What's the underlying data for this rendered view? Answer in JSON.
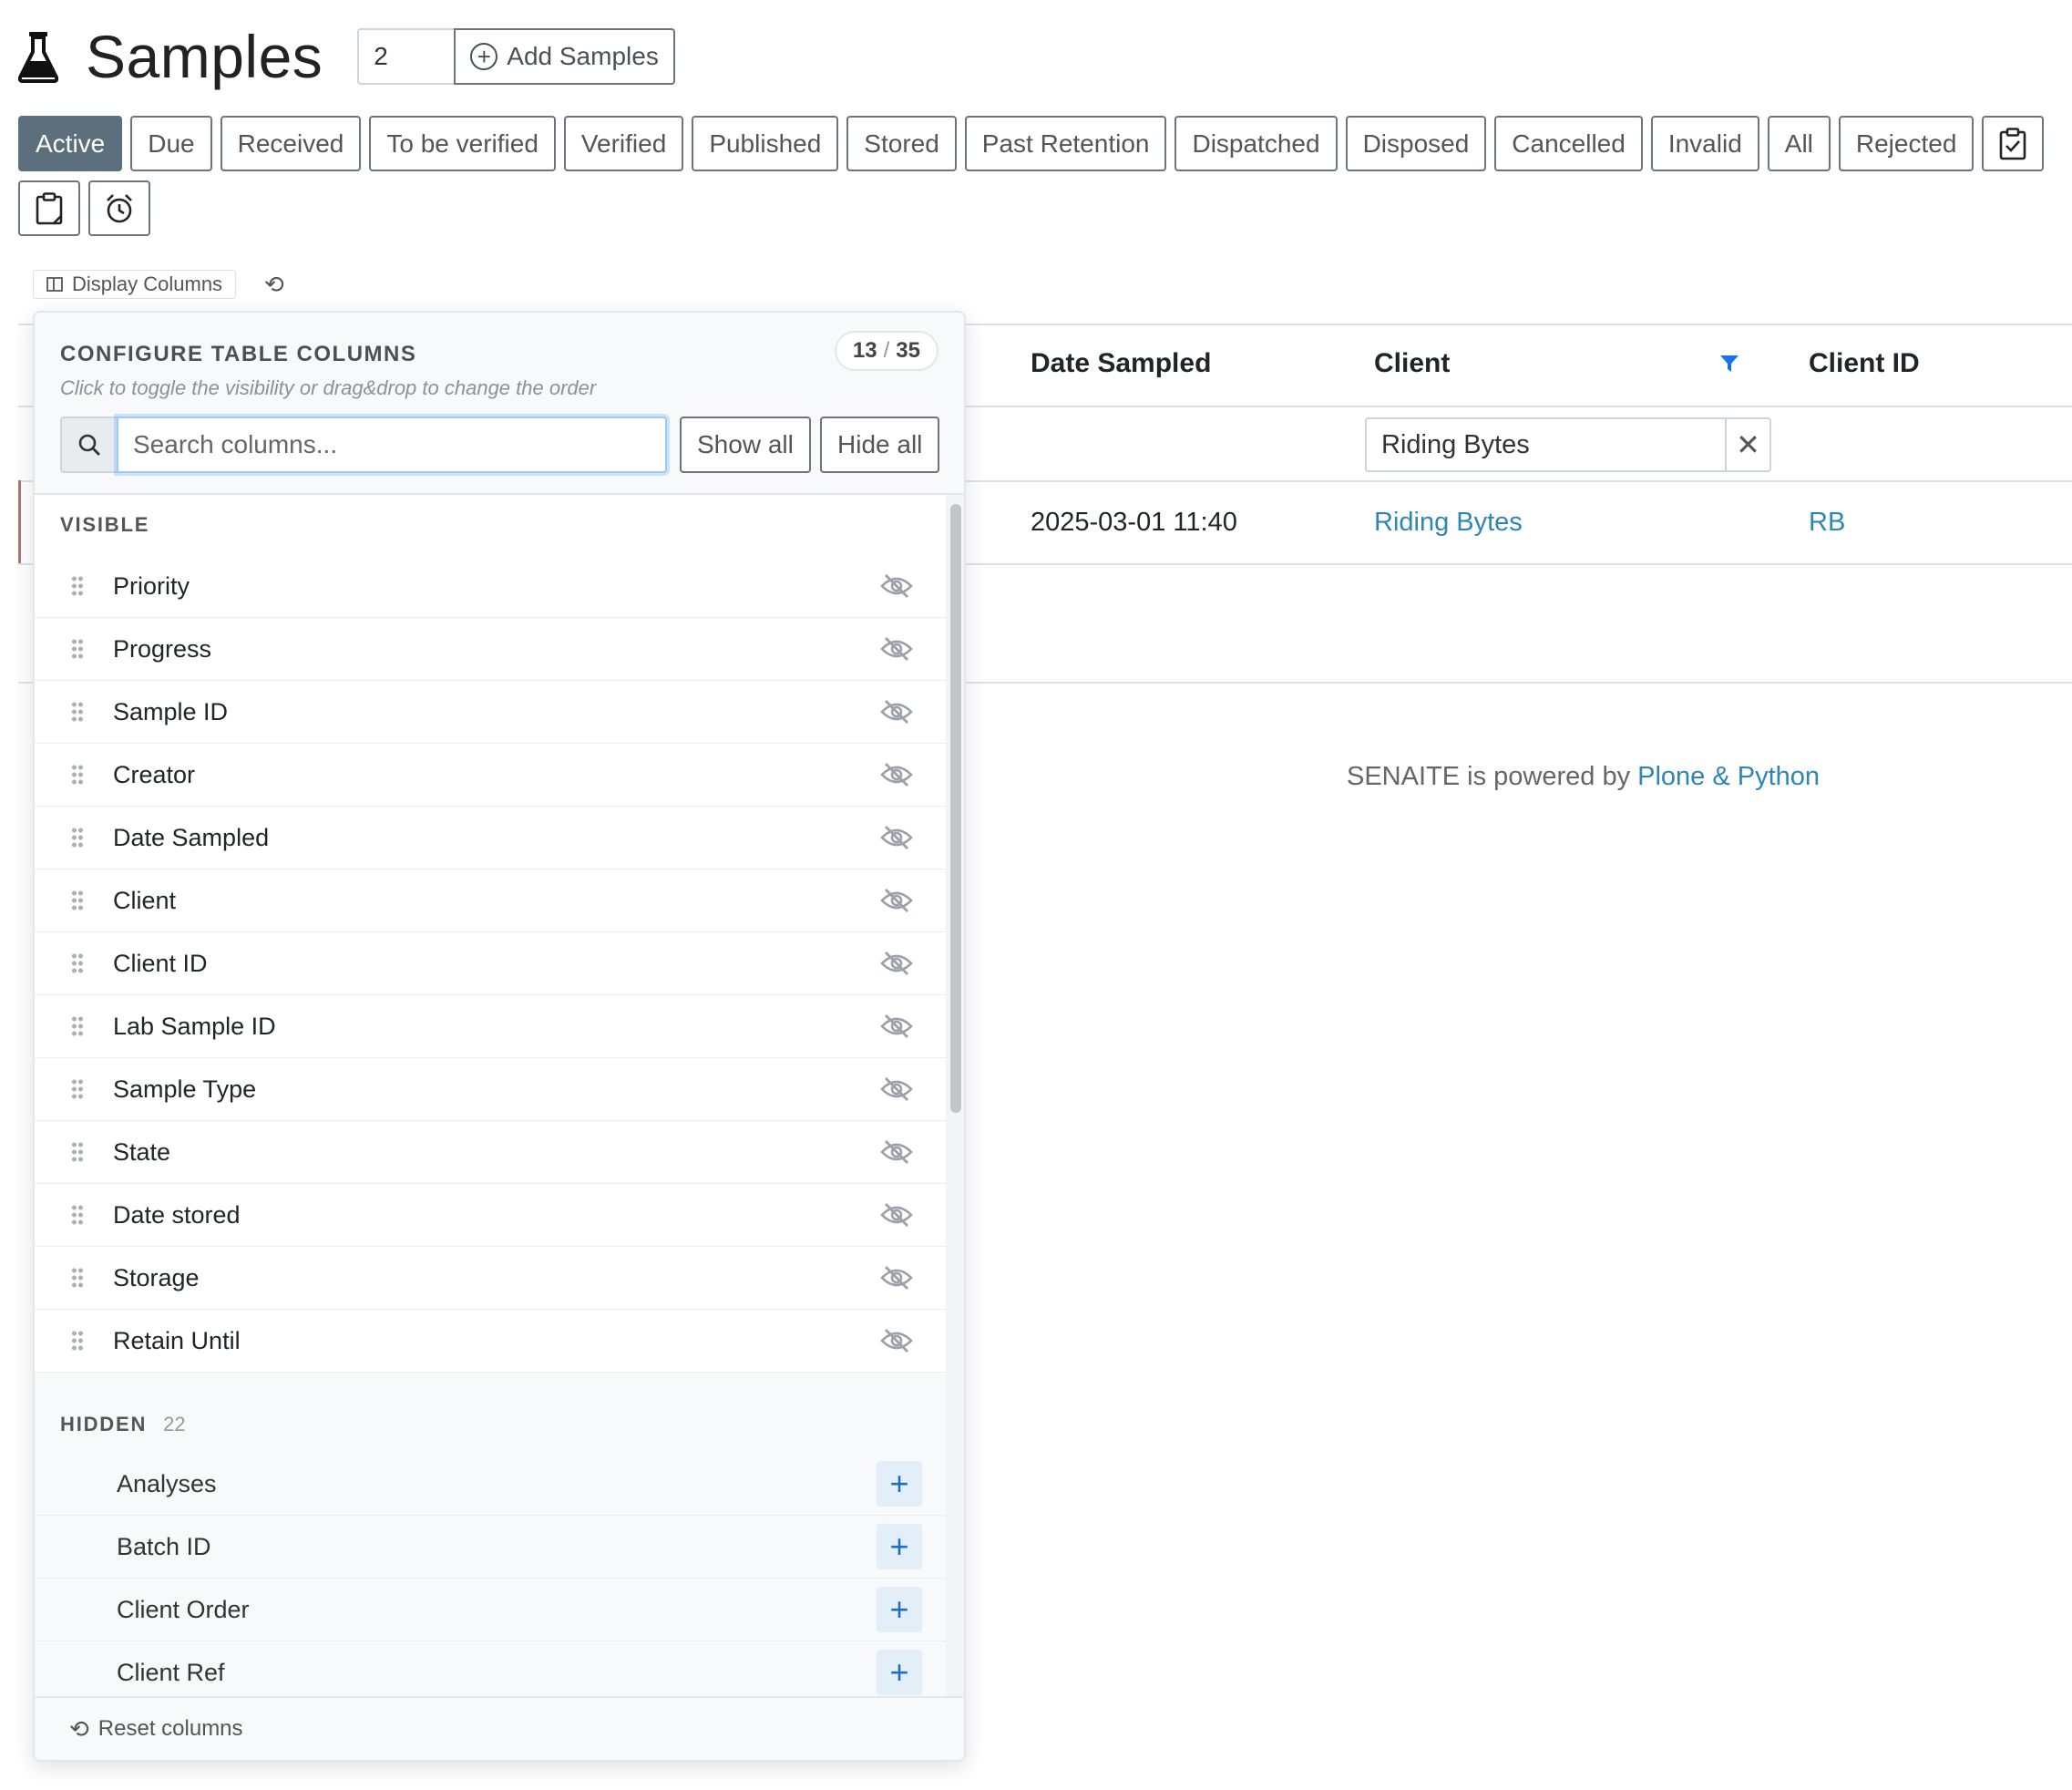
{
  "header": {
    "title": "Samples",
    "count_value": "2",
    "add_button_label": "Add Samples"
  },
  "tabs": [
    "Active",
    "Due",
    "Received",
    "To be verified",
    "Verified",
    "Published",
    "Stored",
    "Past Retention",
    "Dispatched",
    "Disposed",
    "Cancelled",
    "Invalid",
    "All",
    "Rejected"
  ],
  "icon_tabs": [
    "clipboard-check-icon",
    "clipboard-icon",
    "alarm-clock-icon"
  ],
  "toolbar": {
    "display_columns_label": "Display Columns",
    "reset_icon": "reset-icon"
  },
  "table": {
    "headers": {
      "date_sampled": "Date Sampled",
      "client": "Client",
      "client_id": "Client ID"
    },
    "client_filter_value": "Riding Bytes",
    "row": {
      "date_sampled": "2025-03-01 11:40",
      "client": "Riding Bytes",
      "client_id": "RB"
    }
  },
  "footer": {
    "text": "SENAITE is powered by ",
    "link": "Plone & Python"
  },
  "popup": {
    "title": "CONFIGURE TABLE COLUMNS",
    "subtitle": "Click to toggle the visibility or drag&drop to change the order",
    "count_visible": "13",
    "count_total": "35",
    "search_placeholder": "Search columns...",
    "show_all_label": "Show all",
    "hide_all_label": "Hide all",
    "visible_heading": "VISIBLE",
    "visible_columns": [
      "Priority",
      "Progress",
      "Sample ID",
      "Creator",
      "Date Sampled",
      "Client",
      "Client ID",
      "Lab Sample ID",
      "Sample Type",
      "State",
      "Date stored",
      "Storage",
      "Retain Until"
    ],
    "hidden_heading": "HIDDEN",
    "hidden_count": "22",
    "hidden_columns": [
      "Analyses",
      "Batch ID",
      "Client Order",
      "Client Ref"
    ],
    "reset_label": "Reset columns"
  },
  "colors": {
    "active_tab": "#5c6f7c",
    "link": "#2e86b4",
    "filter_icon": "#1a73e8",
    "add_icon": "#1f6fc0"
  }
}
